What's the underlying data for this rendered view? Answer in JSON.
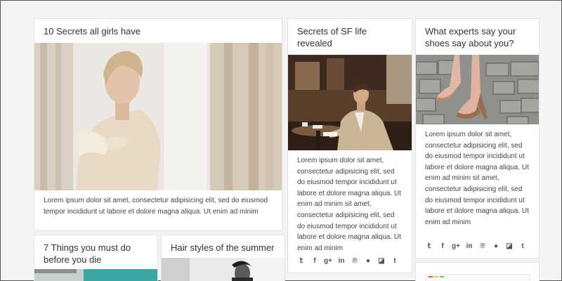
{
  "cards": [
    {
      "title": "10 Secrets all girls have",
      "body": "Lorem ipsum dolor sit amet, consectetur adipisicing elit, sed do eiusmod tempor incididunt ut labore et dolore magna aliqua. Ut enim ad minim"
    },
    {
      "title": "Secrets of SF life revealed",
      "body": "Lorem ipsum dolor sit amet, consectetur adipisicing elit, sed do eiusmod tempor incididunt ut labore et dolore magna aliqua. Ut enim ad minim sit amet, consectetur adipisicing elit, sed do eiusmod tempor incididunt ut labore et dolore magna aliqua. Ut enim ad minim"
    },
    {
      "title": "What experts say your shoes say about you?",
      "body": "Lorem ipsum dolor sit amet, consectetur adipisicing elit, sed do eiusmod tempor incididunt ut labore et dolore magna aliqua. Ut enim ad minim sit amet, consectetur adipisicing elit, sed do eiusmod tempor incididunt ut labore et dolore magna aliqua. Ut enim ad minim"
    },
    {
      "title": "7 Things you must do before you die"
    },
    {
      "title": "Hair styles of the summer"
    }
  ],
  "social_icons": [
    "twitter-icon",
    "facebook-icon",
    "google-plus-icon",
    "linkedin-icon",
    "pinterest-icon",
    "reddit-icon",
    "delicious-icon",
    "tumblr-icon"
  ]
}
